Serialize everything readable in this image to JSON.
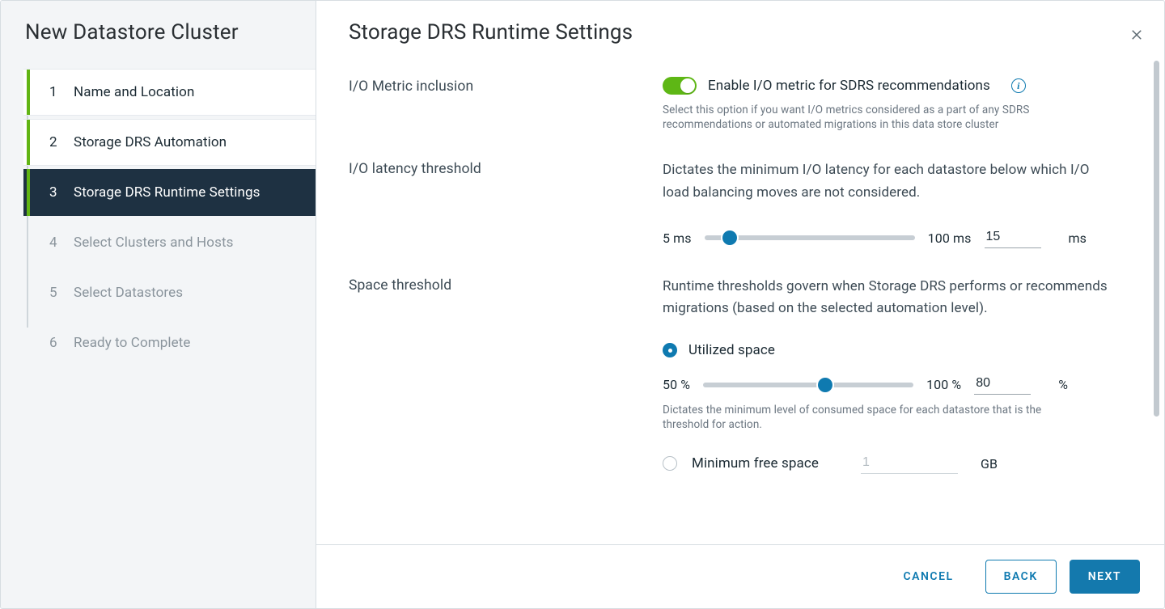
{
  "sidebar": {
    "title": "New Datastore Cluster",
    "steps": [
      {
        "num": "1",
        "label": "Name and Location",
        "state": "done"
      },
      {
        "num": "2",
        "label": "Storage DRS Automation",
        "state": "done"
      },
      {
        "num": "3",
        "label": "Storage DRS Runtime Settings",
        "state": "current"
      },
      {
        "num": "4",
        "label": "Select Clusters and Hosts",
        "state": "future"
      },
      {
        "num": "5",
        "label": "Select Datastores",
        "state": "future"
      },
      {
        "num": "6",
        "label": "Ready to Complete",
        "state": "future"
      }
    ]
  },
  "page": {
    "title": "Storage DRS Runtime Settings"
  },
  "io_metric": {
    "label": "I/O Metric inclusion",
    "toggle_label": "Enable I/O metric for SDRS recommendations",
    "enabled": true,
    "help": "Select this option if you want I/O metrics considered as a part of any SDRS recommendations or automated migrations in this data store cluster"
  },
  "io_latency": {
    "label": "I/O latency threshold",
    "desc": "Dictates the minimum I/O latency for each datastore below which I/O load balancing moves are not considered.",
    "min_label": "5 ms",
    "max_label": "100 ms",
    "value": "15",
    "unit": "ms",
    "slider_percent": 12
  },
  "space": {
    "label": "Space threshold",
    "desc": "Runtime thresholds govern when Storage DRS performs or recommends migrations (based on the selected automation level).",
    "utilized": {
      "radio_label": "Utilized space",
      "checked": true,
      "min_label": "50 %",
      "max_label": "100 %",
      "value": "80",
      "unit": "%",
      "slider_percent": 58,
      "help": "Dictates the minimum level of consumed space for each datastore that is the threshold for action."
    },
    "minfree": {
      "radio_label": "Minimum free space",
      "checked": false,
      "value": "1",
      "unit": "GB"
    }
  },
  "footer": {
    "cancel": "CANCEL",
    "back": "BACK",
    "next": "NEXT"
  }
}
